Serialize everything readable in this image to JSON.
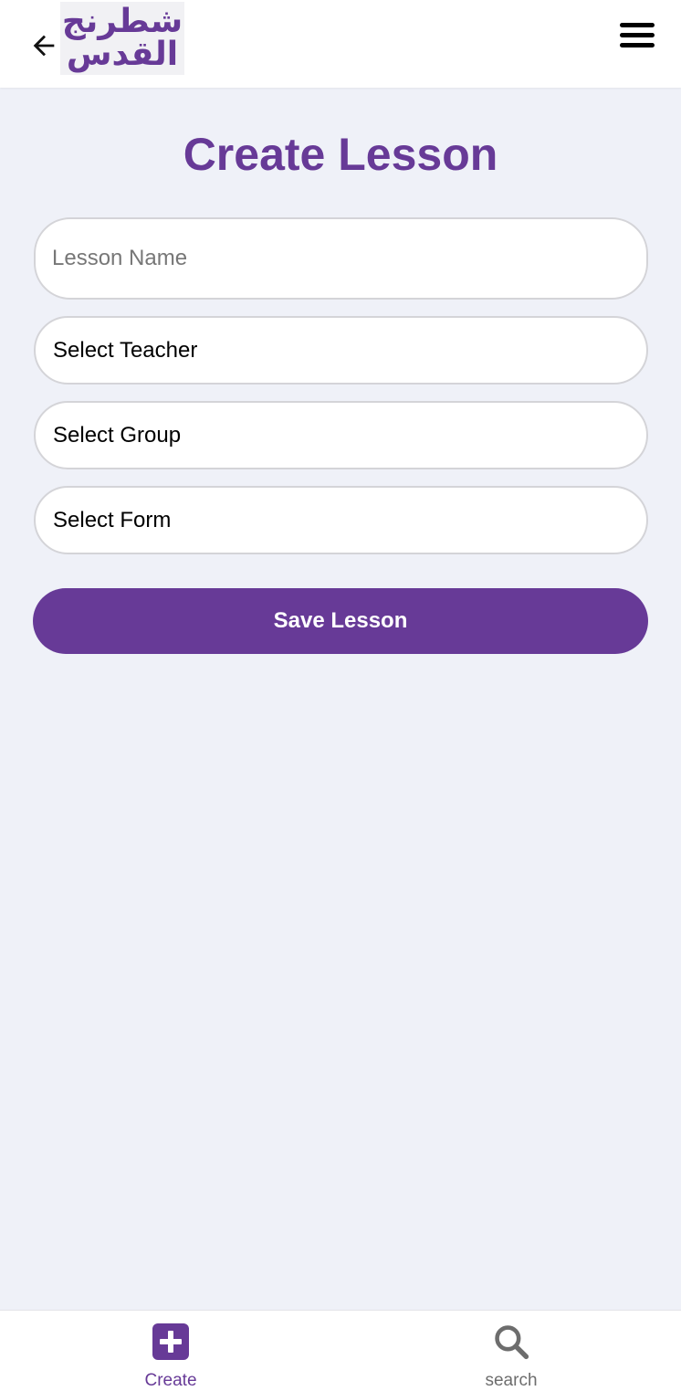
{
  "header": {
    "logo_line1": "شطرنج",
    "logo_line2": "القدس",
    "back_icon": "arrow-left-icon",
    "menu_icon": "hamburger-menu-icon"
  },
  "page": {
    "title": "Create Lesson"
  },
  "form": {
    "lesson_name_placeholder": "Lesson Name",
    "lesson_name_value": "",
    "teacher_select_label": "Select Teacher",
    "group_select_label": "Select Group",
    "form_select_label": "Select Form",
    "save_label": "Save Lesson"
  },
  "bottom_nav": {
    "items": [
      {
        "label": "Create",
        "icon": "plus-square-icon",
        "active": true
      },
      {
        "label": "search",
        "icon": "search-icon",
        "active": false
      }
    ]
  },
  "colors": {
    "brand": "#673a97",
    "background": "#eff1f8",
    "inactive": "#6d6d6d"
  }
}
